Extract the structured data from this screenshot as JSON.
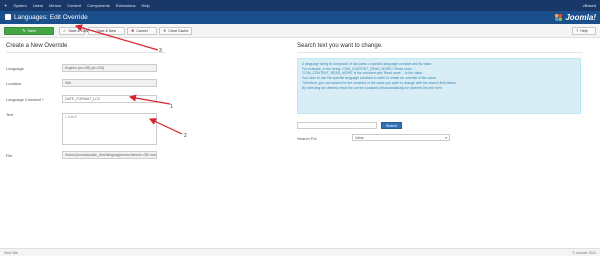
{
  "topbar": {
    "menu": [
      "System",
      "Users",
      "Menus",
      "Content",
      "Components",
      "Extensions",
      "Help"
    ],
    "user": "vBased"
  },
  "header": {
    "title": "Languages: Edit Override",
    "logo_text": "Joomla!"
  },
  "toolbar": {
    "save": "Save",
    "save_close": "Save & Close",
    "save_new": "Save & New",
    "cancel": "Cancel",
    "clear_cache": "Clear Cache",
    "help": "Help"
  },
  "left": {
    "heading": "Create a New Override",
    "fields": {
      "language_label": "Language",
      "language_value": "English (en-GB) [en-GB]",
      "location_label": "Location",
      "location_value": "Site",
      "constant_label": "Language Constant *",
      "constant_value": "DATE_FORMAT_LC2",
      "text_label": "Text",
      "text_value": "l, d.m.Y",
      "file_label": "File",
      "file_value": "/home/joomla/public_html/language/overrides/en-GB.override.ini"
    }
  },
  "right": {
    "heading": "Search text you want to change.",
    "info_lines": [
      "A language string is composed of two parts: a specific language constant and its value.",
      "For example, in the string: COM_CONTENT_READ_MORE=\"Read more...\"",
      "'COM_CONTENT_READ_MORE' is the constant and 'Read more...' is the value.",
      "You have to use the specific language constant in order to create an override of the value.",
      "Therefore, you can search for the constant or the value you want to change with the search field below.",
      "By selecting the desired result the correct constant will automatically be inserted into the form."
    ],
    "search_button": "Search",
    "search_for_label": "Search For",
    "search_for_value": "Value"
  },
  "annotations": {
    "one": "1",
    "two": "2",
    "three": "3"
  },
  "footer": {
    "left": "View Site",
    "right": "© Joomla! 2024"
  },
  "colors": {
    "topbar": "#1a3867",
    "header": "#1a4f8b",
    "save": "#46a546",
    "info": "#d9edf7",
    "arrow": "#d9232e"
  }
}
